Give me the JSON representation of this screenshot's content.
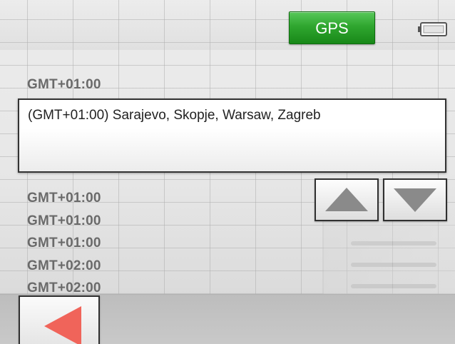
{
  "status_bar": {
    "gps_label": "GPS",
    "gps_color": "#2fa62f",
    "battery_icon": "battery-icon"
  },
  "timezone": {
    "current_label": "GMT+01:00",
    "selected_value": "(GMT+01:00) Sarajevo, Skopje, Warsaw, Zagreb",
    "options": [
      "GMT+01:00",
      "GMT+01:00",
      "GMT+01:00",
      "GMT+02:00",
      "GMT+02:00"
    ]
  },
  "controls": {
    "scroll_up_icon": "triangle-up-icon",
    "scroll_down_icon": "triangle-down-icon",
    "back_icon": "back-arrow-icon",
    "back_color": "#f0645a",
    "arrow_color": "#8a8a8a"
  }
}
